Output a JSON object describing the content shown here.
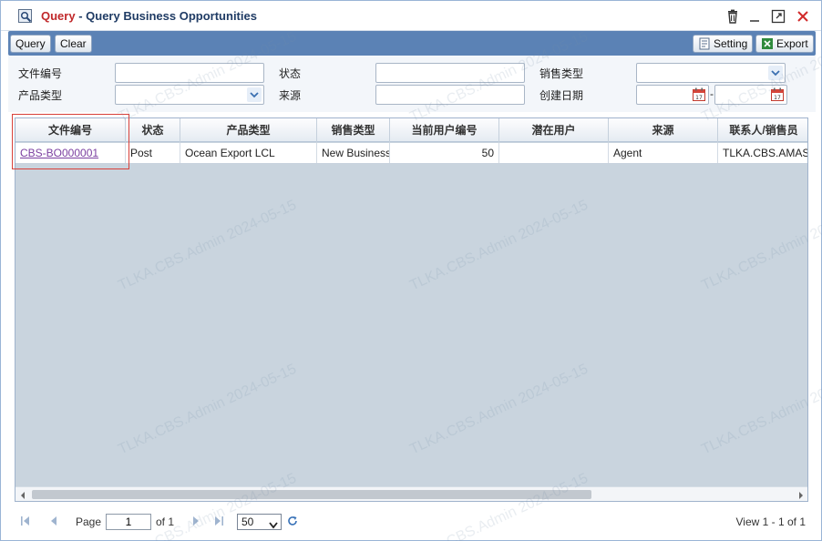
{
  "window": {
    "title_prefix": "Query",
    "title_separator": " - ",
    "title_main": "Query Business Opportunities"
  },
  "toolbar": {
    "query_label": "Query",
    "clear_label": "Clear",
    "setting_label": "Setting",
    "export_label": "Export"
  },
  "form": {
    "doc_no_label": "文件编号",
    "status_label": "状态",
    "sales_type_label": "销售类型",
    "product_type_label": "产品类型",
    "source_label": "来源",
    "created_date_label": "创建日期",
    "date_separator": "-"
  },
  "grid": {
    "columns": [
      "文件编号",
      "状态",
      "产品类型",
      "销售类型",
      "当前用户编号",
      "潜在用户",
      "来源",
      "联系人/销售员"
    ],
    "rows": [
      [
        "CBS-BO000001",
        "Post",
        "Ocean Export LCL",
        "New Business",
        "50",
        "",
        "Agent",
        "TLKA.CBS.AMAS"
      ]
    ]
  },
  "pager": {
    "page_label": "Page",
    "page_value": "1",
    "of_label": "of 1",
    "page_size": "50",
    "view_text": "View 1 - 1 of 1"
  },
  "watermark": "TLKA.CBS.Admin 2024-05-15",
  "colors": {
    "toolbar_bg": "#5b82b5",
    "title_red": "#c0282a",
    "title_blue": "#1f3b64",
    "link": "#7b3fa0",
    "highlight_border": "#d9413a"
  },
  "icons": [
    "query-window-icon",
    "trash-icon",
    "minimize-icon",
    "maximize-icon",
    "close-icon",
    "setting-icon",
    "export-excel-icon",
    "calendar-icon",
    "first-page-icon",
    "prev-page-icon",
    "next-page-icon",
    "last-page-icon",
    "refresh-icon"
  ]
}
